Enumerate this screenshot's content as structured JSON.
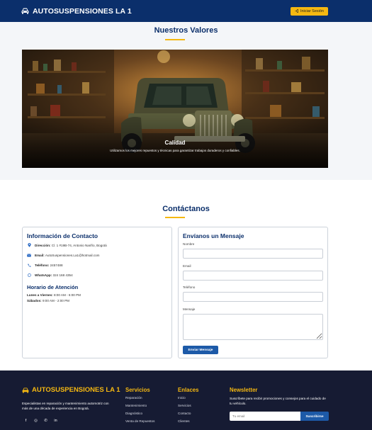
{
  "header": {
    "brand": "AUTOSUSPENSIONES LA 1",
    "login_label": "Iniciar Sesión"
  },
  "values": {
    "title": "Nuestros Valores",
    "slide_title": "Calidad",
    "slide_text": "Utilizamos los mejores repuestos y técnicas para garantizar trabajos duraderos y confiables."
  },
  "contact": {
    "title": "Contáctanos",
    "info_title": "Información de Contacto",
    "address_label": "Dirección:",
    "address_value": "Cl. 1 #19B-74, Antonio Nariño, Bogotá",
    "email_label": "Email:",
    "email_value": "AutoSuspensiones.La1@hotmail.com",
    "phone_label": "Teléfono:",
    "phone_value": "2457488",
    "whatsapp_label": "WhatsApp:",
    "whatsapp_value": "324 168 4354",
    "hours_title": "Horario de Atención",
    "weekdays_label": "Lunes a Viernes:",
    "weekdays_value": "8:00 AM - 6:00 PM",
    "saturday_label": "Sábados:",
    "saturday_value": "9:00 AM - 2:00 PM",
    "form_title": "Envíanos un Mensaje",
    "name_label": "Nombre",
    "email_field_label": "Email",
    "phone_field_label": "Teléfono",
    "message_label": "Mensaje",
    "send_label": "Enviar Mensaje"
  },
  "footer": {
    "brand": "AUTOSUSPENSIONES LA 1",
    "description": "Especialistas en reparación y mantenimiento automotriz con más de una década de experiencia en Bogotá.",
    "services_title": "Servicios",
    "services": [
      "Reparación",
      "Mantenimiento",
      "Diagnóstico",
      "Venta de Repuestos"
    ],
    "links_title": "Enlaces",
    "links": [
      "Inicio",
      "Servicios",
      "Contacto",
      "Clientes"
    ],
    "newsletter_title": "Newsletter",
    "newsletter_text": "Suscríbete para recibir promociones y consejos para el cuidado de tu vehículo.",
    "newsletter_placeholder": "Tu email",
    "subscribe_label": "Suscribirse",
    "socials": [
      "f",
      "◎",
      "✆",
      "in"
    ]
  },
  "colors": {
    "navy": "#0b2f6b",
    "accent": "#f5b811",
    "button_blue": "#1d5aa8",
    "footer_bg": "#161b33"
  }
}
